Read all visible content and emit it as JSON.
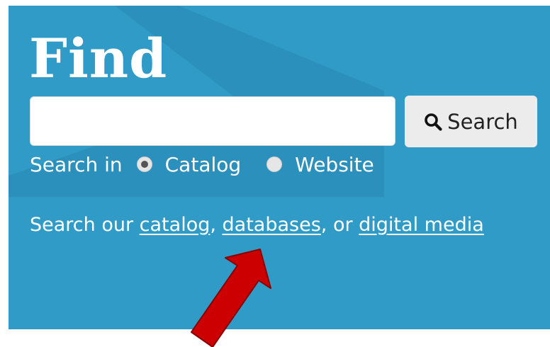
{
  "find": {
    "title": "Find",
    "search_input": {
      "value": "",
      "placeholder": ""
    },
    "search_button_label": "Search",
    "search_in_label": "Search in",
    "options": [
      {
        "label": "Catalog",
        "selected": true
      },
      {
        "label": "Website",
        "selected": false
      }
    ],
    "info": {
      "prefix": "Search our ",
      "link_catalog": "catalog",
      "sep1": ", ",
      "link_databases": "databases",
      "sep2": ", or ",
      "link_digital_media": "digital media"
    }
  },
  "colors": {
    "panel_bg": "#309bc6",
    "panel_shape": "#2a8cb6",
    "button_bg": "#ececec",
    "arrow": "#cc0000"
  },
  "icons": {
    "search_button": "magnifier-icon",
    "annotation": "red-arrow-icon"
  }
}
